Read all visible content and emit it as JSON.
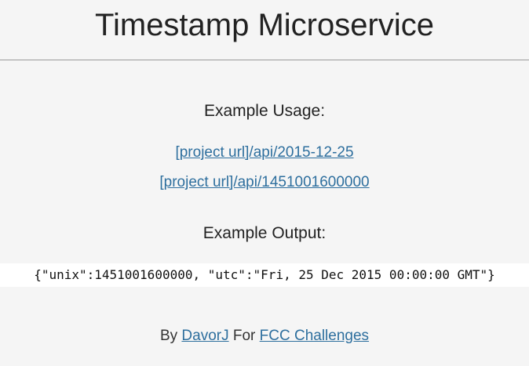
{
  "header": {
    "title": "Timestamp Microservice"
  },
  "usage": {
    "heading": "Example Usage:",
    "links": [
      "[project url]/api/2015-12-25",
      "[project url]/api/1451001600000"
    ]
  },
  "output": {
    "heading": "Example Output:",
    "code": "{\"unix\":1451001600000, \"utc\":\"Fri, 25 Dec 2015 00:00:00 GMT\"}"
  },
  "footer": {
    "by_text": "By",
    "author_link": "DavorJ",
    "for_text": "For",
    "challenge_link": "FCC Challenges"
  },
  "colors": {
    "background": "#f5f5f5",
    "link": "#2e6f9e",
    "text": "#222222",
    "divider": "#9a9a9a"
  }
}
